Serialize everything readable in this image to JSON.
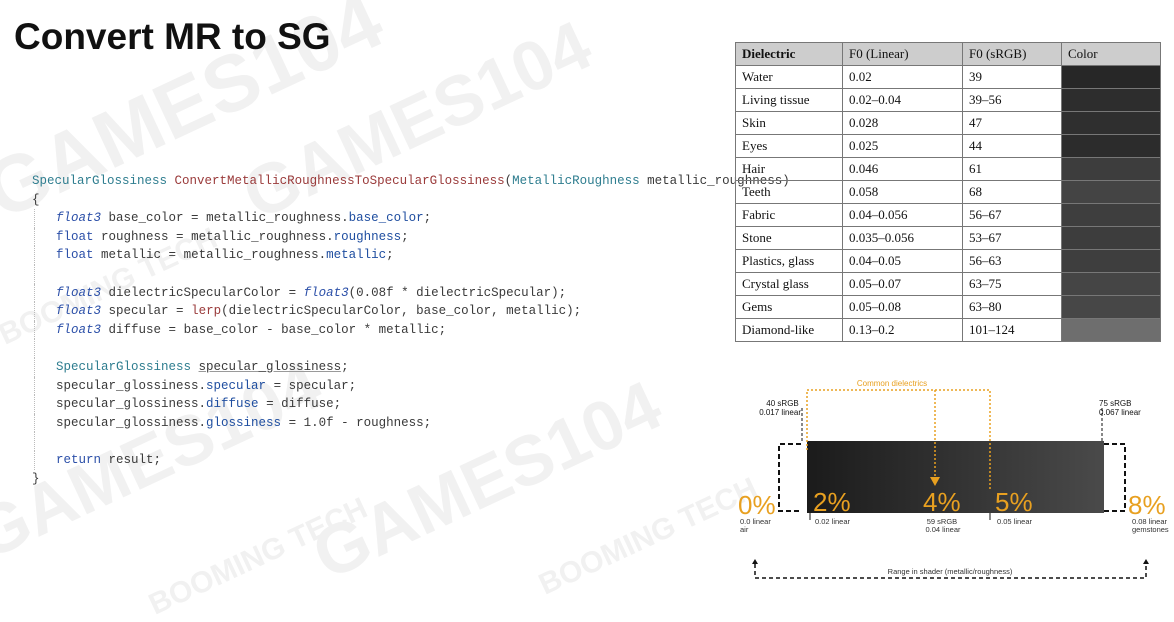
{
  "title": "Convert MR to SG",
  "watermarks": [
    "GAMES104",
    "GAMES104",
    "BOOMING TECH",
    "GAMES104",
    "BOOMING TECH",
    "GAMES104",
    "BOOMING TECH"
  ],
  "code": {
    "l1": {
      "type": "SpecularGlossiness",
      "fn": "ConvertMetallicRoughnessToSpecularGlossiness",
      "ptype": "MetallicRoughness",
      "pname": "metallic_roughness"
    },
    "l2": "{",
    "l3": {
      "type": "float3",
      "name": "base_color",
      "src": "metallic_roughness",
      "field": "base_color"
    },
    "l4": {
      "type": "float",
      "name": "roughness",
      "src": "metallic_roughness",
      "field": "roughness"
    },
    "l5": {
      "type": "float",
      "name": "metallic",
      "src": "metallic_roughness",
      "field": "metallic"
    },
    "l6": {
      "type": "float3",
      "name": "dielectricSpecularColor",
      "ctor": "float3",
      "args": "(0.08f * dielectricSpecular);"
    },
    "l7": {
      "type": "float3",
      "name": "specular",
      "fn": "lerp",
      "args": "(dielectricSpecularColor, base_color, metallic);"
    },
    "l8": {
      "type": "float3",
      "name": "diffuse",
      "expr": "base_color - base_color * metallic;"
    },
    "l9": {
      "type": "SpecularGlossiness",
      "name": "specular_glossiness"
    },
    "l10": {
      "obj": "specular_glossiness",
      "field": "specular",
      "rhs": "specular;"
    },
    "l11": {
      "obj": "specular_glossiness",
      "field": "diffuse",
      "rhs": "diffuse;"
    },
    "l12": {
      "obj": "specular_glossiness",
      "field": "glossiness",
      "rhs": "1.0f - roughness;"
    },
    "l13": {
      "kw": "return",
      "rest": "result;"
    },
    "l14": "}"
  },
  "table": {
    "headers": [
      "Dielectric",
      "F0 (Linear)",
      "F0 (sRGB)",
      "Color"
    ],
    "rows": [
      {
        "name": "Water",
        "linear": "0.02",
        "srgb": "39",
        "color": "#272727"
      },
      {
        "name": "Living tissue",
        "linear": "0.02–0.04",
        "srgb": "39–56",
        "color": "#2d2d2d"
      },
      {
        "name": "Skin",
        "linear": "0.028",
        "srgb": "47",
        "color": "#2f2f2f"
      },
      {
        "name": "Eyes",
        "linear": "0.025",
        "srgb": "44",
        "color": "#2c2c2c"
      },
      {
        "name": "Hair",
        "linear": "0.046",
        "srgb": "61",
        "color": "#3d3d3d"
      },
      {
        "name": "Teeth",
        "linear": "0.058",
        "srgb": "68",
        "color": "#444444"
      },
      {
        "name": "Fabric",
        "linear": "0.04–0.056",
        "srgb": "56–67",
        "color": "#3e3e3e"
      },
      {
        "name": "Stone",
        "linear": "0.035–0.056",
        "srgb": "53–67",
        "color": "#3d3d3d"
      },
      {
        "name": "Plastics, glass",
        "linear": "0.04–0.05",
        "srgb": "56–63",
        "color": "#3e3e3e"
      },
      {
        "name": "Crystal glass",
        "linear": "0.05–0.07",
        "srgb": "63–75",
        "color": "#454545"
      },
      {
        "name": "Gems",
        "linear": "0.05–0.08",
        "srgb": "63–80",
        "color": "#474747"
      },
      {
        "name": "Diamond-like",
        "linear": "0.13–0.2",
        "srgb": "101–124",
        "color": "#6e6e6e"
      }
    ]
  },
  "diagram": {
    "common_label": "Common dielectrics",
    "left_top": [
      "40 sRGB",
      "0.017 linear"
    ],
    "right_top": [
      "75 sRGB",
      "0.067 linear"
    ],
    "markers": [
      {
        "pct": "0%",
        "sub": [
          "0.0 linear",
          "air"
        ]
      },
      {
        "pct": "2%",
        "sub": [
          "0.02 linear"
        ]
      },
      {
        "pct": "4%",
        "sub": [
          "59 sRGB",
          "0.04 linear"
        ]
      },
      {
        "pct": "5%",
        "sub": [
          "0.05 linear"
        ]
      },
      {
        "pct": "8%",
        "sub": [
          "0.08 linear",
          "gemstones"
        ]
      }
    ],
    "range_label": "Range in shader (metallic/roughness)",
    "accent": "#e8a020"
  }
}
